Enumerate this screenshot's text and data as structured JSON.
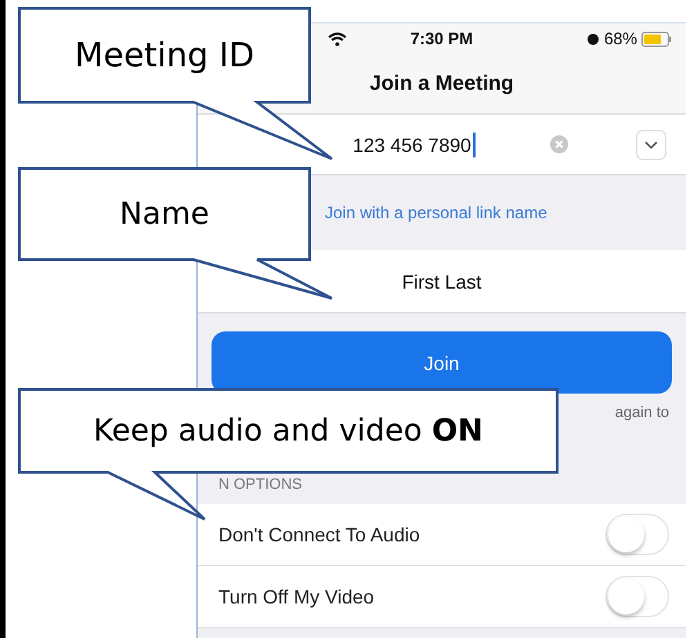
{
  "callouts": [
    {
      "text": "Meeting ID"
    },
    {
      "text": "Name"
    },
    {
      "text": "Keep audio and video **ON**"
    }
  ],
  "status_bar": {
    "time": "7:30 PM",
    "battery": "68%"
  },
  "title": "Join a Meeting",
  "meeting_id": {
    "value": "123 456 7890"
  },
  "personal_link": "Join with a personal link name",
  "name": {
    "value": "First Last"
  },
  "join_button": "Join",
  "note": "again to",
  "section_header": "N OPTIONS",
  "options": [
    {
      "label": "Don't Connect To Audio",
      "on": false
    },
    {
      "label": "Turn Off My Video",
      "on": false
    }
  ]
}
